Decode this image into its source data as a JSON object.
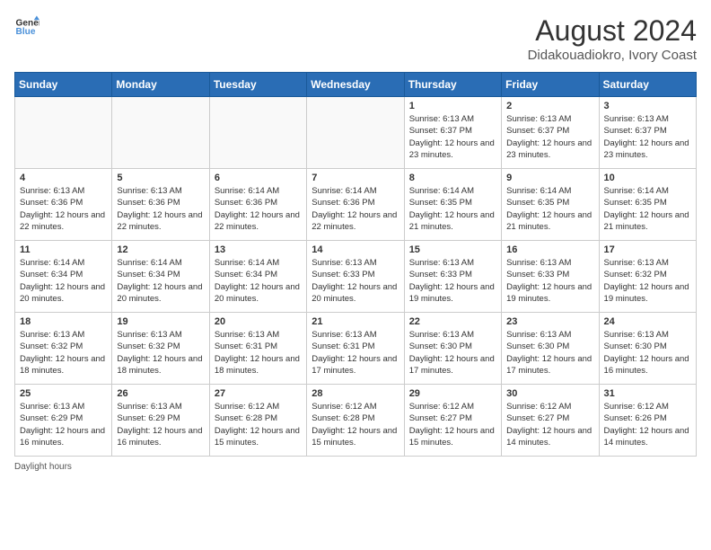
{
  "header": {
    "title": "August 2024",
    "subtitle": "Didakouadiokro, Ivory Coast",
    "logo_line1": "General",
    "logo_line2": "Blue"
  },
  "days_of_week": [
    "Sunday",
    "Monday",
    "Tuesday",
    "Wednesday",
    "Thursday",
    "Friday",
    "Saturday"
  ],
  "footer": "Daylight hours",
  "weeks": [
    [
      {
        "day": "",
        "info": ""
      },
      {
        "day": "",
        "info": ""
      },
      {
        "day": "",
        "info": ""
      },
      {
        "day": "",
        "info": ""
      },
      {
        "day": "1",
        "info": "Sunrise: 6:13 AM\nSunset: 6:37 PM\nDaylight: 12 hours\nand 23 minutes."
      },
      {
        "day": "2",
        "info": "Sunrise: 6:13 AM\nSunset: 6:37 PM\nDaylight: 12 hours\nand 23 minutes."
      },
      {
        "day": "3",
        "info": "Sunrise: 6:13 AM\nSunset: 6:37 PM\nDaylight: 12 hours\nand 23 minutes."
      }
    ],
    [
      {
        "day": "4",
        "info": "Sunrise: 6:13 AM\nSunset: 6:36 PM\nDaylight: 12 hours\nand 22 minutes."
      },
      {
        "day": "5",
        "info": "Sunrise: 6:13 AM\nSunset: 6:36 PM\nDaylight: 12 hours\nand 22 minutes."
      },
      {
        "day": "6",
        "info": "Sunrise: 6:14 AM\nSunset: 6:36 PM\nDaylight: 12 hours\nand 22 minutes."
      },
      {
        "day": "7",
        "info": "Sunrise: 6:14 AM\nSunset: 6:36 PM\nDaylight: 12 hours\nand 22 minutes."
      },
      {
        "day": "8",
        "info": "Sunrise: 6:14 AM\nSunset: 6:35 PM\nDaylight: 12 hours\nand 21 minutes."
      },
      {
        "day": "9",
        "info": "Sunrise: 6:14 AM\nSunset: 6:35 PM\nDaylight: 12 hours\nand 21 minutes."
      },
      {
        "day": "10",
        "info": "Sunrise: 6:14 AM\nSunset: 6:35 PM\nDaylight: 12 hours\nand 21 minutes."
      }
    ],
    [
      {
        "day": "11",
        "info": "Sunrise: 6:14 AM\nSunset: 6:34 PM\nDaylight: 12 hours\nand 20 minutes."
      },
      {
        "day": "12",
        "info": "Sunrise: 6:14 AM\nSunset: 6:34 PM\nDaylight: 12 hours\nand 20 minutes."
      },
      {
        "day": "13",
        "info": "Sunrise: 6:14 AM\nSunset: 6:34 PM\nDaylight: 12 hours\nand 20 minutes."
      },
      {
        "day": "14",
        "info": "Sunrise: 6:13 AM\nSunset: 6:33 PM\nDaylight: 12 hours\nand 20 minutes."
      },
      {
        "day": "15",
        "info": "Sunrise: 6:13 AM\nSunset: 6:33 PM\nDaylight: 12 hours\nand 19 minutes."
      },
      {
        "day": "16",
        "info": "Sunrise: 6:13 AM\nSunset: 6:33 PM\nDaylight: 12 hours\nand 19 minutes."
      },
      {
        "day": "17",
        "info": "Sunrise: 6:13 AM\nSunset: 6:32 PM\nDaylight: 12 hours\nand 19 minutes."
      }
    ],
    [
      {
        "day": "18",
        "info": "Sunrise: 6:13 AM\nSunset: 6:32 PM\nDaylight: 12 hours\nand 18 minutes."
      },
      {
        "day": "19",
        "info": "Sunrise: 6:13 AM\nSunset: 6:32 PM\nDaylight: 12 hours\nand 18 minutes."
      },
      {
        "day": "20",
        "info": "Sunrise: 6:13 AM\nSunset: 6:31 PM\nDaylight: 12 hours\nand 18 minutes."
      },
      {
        "day": "21",
        "info": "Sunrise: 6:13 AM\nSunset: 6:31 PM\nDaylight: 12 hours\nand 17 minutes."
      },
      {
        "day": "22",
        "info": "Sunrise: 6:13 AM\nSunset: 6:30 PM\nDaylight: 12 hours\nand 17 minutes."
      },
      {
        "day": "23",
        "info": "Sunrise: 6:13 AM\nSunset: 6:30 PM\nDaylight: 12 hours\nand 17 minutes."
      },
      {
        "day": "24",
        "info": "Sunrise: 6:13 AM\nSunset: 6:30 PM\nDaylight: 12 hours\nand 16 minutes."
      }
    ],
    [
      {
        "day": "25",
        "info": "Sunrise: 6:13 AM\nSunset: 6:29 PM\nDaylight: 12 hours\nand 16 minutes."
      },
      {
        "day": "26",
        "info": "Sunrise: 6:13 AM\nSunset: 6:29 PM\nDaylight: 12 hours\nand 16 minutes."
      },
      {
        "day": "27",
        "info": "Sunrise: 6:12 AM\nSunset: 6:28 PM\nDaylight: 12 hours\nand 15 minutes."
      },
      {
        "day": "28",
        "info": "Sunrise: 6:12 AM\nSunset: 6:28 PM\nDaylight: 12 hours\nand 15 minutes."
      },
      {
        "day": "29",
        "info": "Sunrise: 6:12 AM\nSunset: 6:27 PM\nDaylight: 12 hours\nand 15 minutes."
      },
      {
        "day": "30",
        "info": "Sunrise: 6:12 AM\nSunset: 6:27 PM\nDaylight: 12 hours\nand 14 minutes."
      },
      {
        "day": "31",
        "info": "Sunrise: 6:12 AM\nSunset: 6:26 PM\nDaylight: 12 hours\nand 14 minutes."
      }
    ]
  ]
}
